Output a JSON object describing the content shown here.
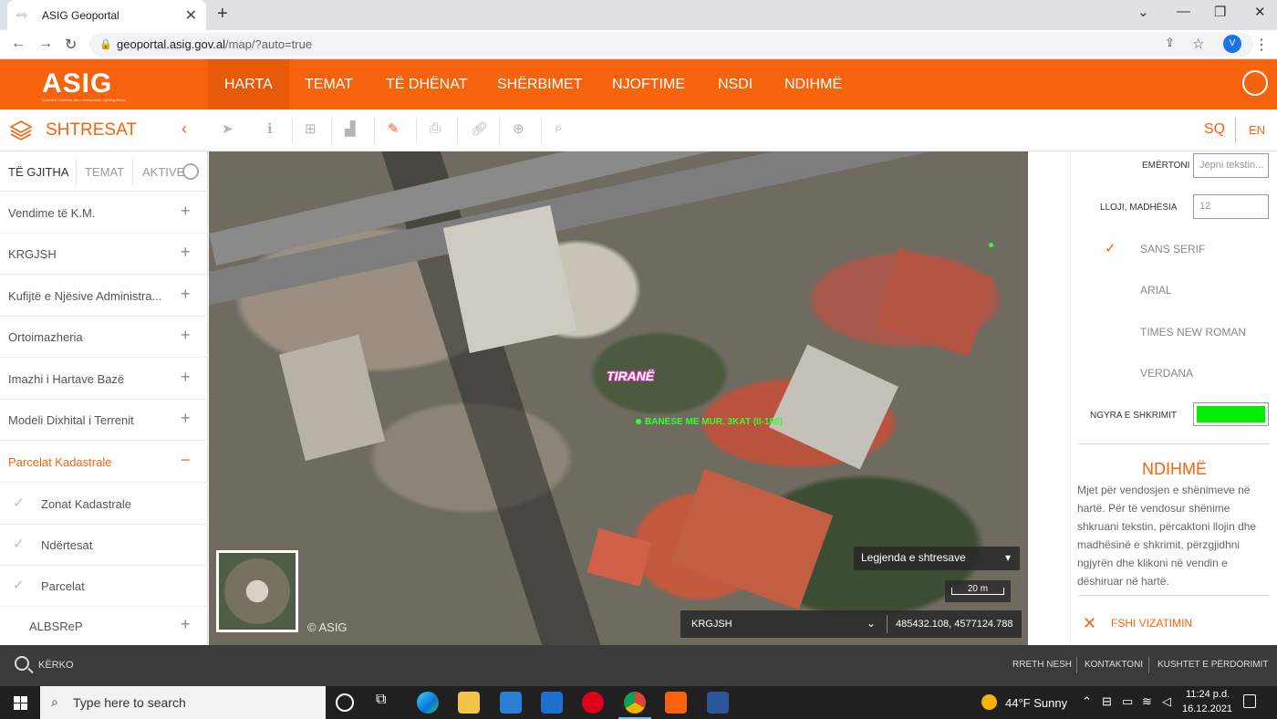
{
  "browser": {
    "tab_title": "ASIG Geoportal",
    "url_host": "geoportal.asig.gov.al",
    "url_path": "/map/?auto=true",
    "profile_initial": "V"
  },
  "header": {
    "logo": "ASIG",
    "logo_sub": "Autoriteti Shtetëror për Informacionin Gjeohapësinor",
    "nav": [
      "HARTA",
      "TEMAT",
      "TË DHËNAT",
      "SHËRBIMET",
      "NJOFTIME",
      "NSDI",
      "NDIHMË"
    ]
  },
  "toolbar": {
    "panel_title": "SHTRESAT",
    "lang_sq": "SQ",
    "lang_en": "EN"
  },
  "sidebar": {
    "tabs": [
      "TË GJITHA",
      "TEMAT",
      "AKTIVE"
    ],
    "items": [
      {
        "label": "Vendime të K.M.",
        "state": "+"
      },
      {
        "label": "KRGJSH",
        "state": "+"
      },
      {
        "label": "Kufijtë e Njësive Administra...",
        "state": "+"
      },
      {
        "label": "Ortoimazheria",
        "state": "+"
      },
      {
        "label": "Imazhi i Hartave Bazë",
        "state": "+"
      },
      {
        "label": "Modeli Dixhital i Terrenit",
        "state": "+"
      },
      {
        "label": "Parcelat Kadastrale",
        "state": "−"
      }
    ],
    "subitems": [
      "Zonat Kadastrale",
      "Ndërtesat",
      "Parcelat"
    ],
    "last_item": {
      "label": "ALBSReP",
      "state": "+"
    }
  },
  "map": {
    "label": "TIRANË",
    "annotation": "BANESE ME MUR. 3KAT (II-180)",
    "copyright": "© ASIG",
    "legend": "Legjenda e shtresave",
    "scale": "20 m",
    "projection": "KRGJSH",
    "coordinates": "485432.108, 4577124.788"
  },
  "text_panel": {
    "name_label": "EMËRTONI",
    "name_placeholder": "Jepni tekstin...",
    "size_label": "LLOJI, MADHËSIA",
    "size_value": "12",
    "fonts": [
      "SANS SERIF",
      "ARIAL",
      "TIMES NEW ROMAN",
      "VERDANA"
    ],
    "selected_font": "SANS SERIF",
    "color_label": "NGYRA E SHKRIMIT",
    "color_value": "#00f000",
    "help_title": "NDIHMË",
    "help_text": "Mjet për vendosjen e shënimeve në hartë. Për të vendosur shënime shkruani tekstin, përcaktoni llojin dhe madhësinë e shkrimit, përzgjidhni ngjyrën dhe klikoni në vendin e dëshiruar në hartë.",
    "clear_button": "FSHI VIZATIMIN"
  },
  "footer": {
    "search": "KËRKO",
    "links": [
      "RRETH NESH",
      "KONTAKTONI",
      "KUSHTET E PËRDORIMIT"
    ]
  },
  "taskbar": {
    "search_placeholder": "Type here to search",
    "weather": "44°F  Sunny",
    "time": "11:24 p.d.",
    "date": "16.12.2021"
  },
  "colors": {
    "brand": "#f7630c",
    "text_color_swatch": "#00f000"
  }
}
